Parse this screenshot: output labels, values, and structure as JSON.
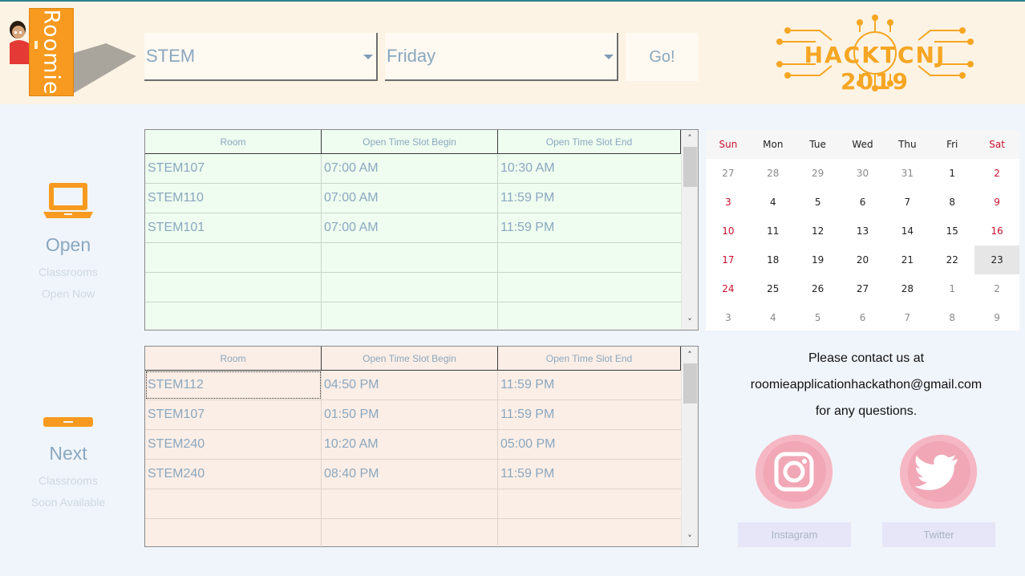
{
  "header": {
    "logo_text": "Roomie",
    "building_select": {
      "value": "STEM"
    },
    "day_select": {
      "value": "Friday"
    },
    "go_label": "Go!",
    "hackathon_logo": "HACKTCNJ 2019"
  },
  "open_section": {
    "title": "Open",
    "line1": "Classrooms",
    "line2": "Open Now",
    "icon": "laptop-icon"
  },
  "next_section": {
    "title": "Next",
    "line1": "Classrooms",
    "line2": "Soon Available",
    "icon": "minus-bar-icon"
  },
  "open_table": {
    "columns": [
      "Room",
      "Open Time Slot Begin",
      "Open Time Slot End"
    ],
    "rows": [
      [
        "STEM107",
        "07:00 AM",
        "10:30 AM"
      ],
      [
        "STEM110",
        "07:00 AM",
        "11:59 PM"
      ],
      [
        "STEM101",
        "07:00 AM",
        "11:59 PM"
      ],
      [
        "",
        "",
        ""
      ],
      [
        "",
        "",
        ""
      ],
      [
        "",
        "",
        ""
      ]
    ]
  },
  "next_table": {
    "columns": [
      "Room",
      "Open Time Slot Begin",
      "Open Time Slot End"
    ],
    "rows": [
      [
        "STEM112",
        "04:50 PM",
        "11:59 PM"
      ],
      [
        "STEM107",
        "01:50 PM",
        "11:59 PM"
      ],
      [
        "STEM240",
        "10:20 AM",
        "05:00 PM"
      ],
      [
        "STEM240",
        "08:40 PM",
        "11:59 PM"
      ],
      [
        "",
        "",
        ""
      ],
      [
        "",
        "",
        ""
      ]
    ]
  },
  "calendar": {
    "weekdays": [
      "Sun",
      "Mon",
      "Tue",
      "Wed",
      "Thu",
      "Fri",
      "Sat"
    ],
    "weeks": [
      [
        "27",
        "28",
        "29",
        "30",
        "31",
        "1",
        "2"
      ],
      [
        "3",
        "4",
        "5",
        "6",
        "7",
        "8",
        "9"
      ],
      [
        "10",
        "11",
        "12",
        "13",
        "14",
        "15",
        "16"
      ],
      [
        "17",
        "18",
        "19",
        "20",
        "21",
        "22",
        "23"
      ],
      [
        "24",
        "25",
        "26",
        "27",
        "28",
        "1",
        "2"
      ],
      [
        "3",
        "4",
        "5",
        "6",
        "7",
        "8",
        "9"
      ]
    ],
    "selected": "23"
  },
  "contact": {
    "line1": "Please contact us at",
    "email": "roomieapplicationhackathon@gmail.com",
    "line3": "for any questions."
  },
  "social": {
    "instagram_label": "Instagram",
    "twitter_label": "Twitter"
  },
  "colors": {
    "accent": "#f79a1f",
    "text_muted": "#8aa7bf",
    "open_table_bg": "#effdf0",
    "next_table_bg": "#fbeee6",
    "weekend_red": "#c8102e",
    "social_pink": "#f2a4b4"
  }
}
